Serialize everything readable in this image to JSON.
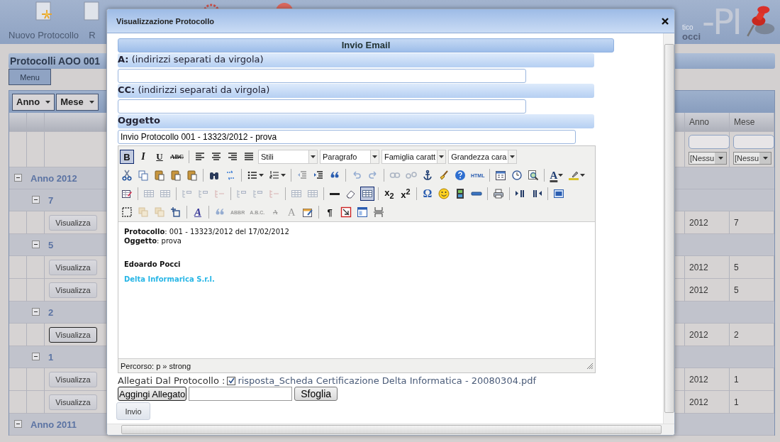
{
  "header": {
    "buttons": [
      {
        "label": "Nuovo Protocollo"
      },
      {
        "label": "R"
      }
    ],
    "logo": {
      "text": "-PI",
      "tagline": "tico",
      "user": "occi"
    }
  },
  "page_title": "Protocolli AOO 001",
  "menu_button": "Menu",
  "grid": {
    "group_by": [
      "Anno",
      "Mese"
    ],
    "columns": [
      "Anno",
      "Mese"
    ],
    "filters": [
      "[Nessu",
      "[Nessu"
    ],
    "groups": [
      {
        "label": "Anno 2012",
        "expanded": true,
        "children": [
          {
            "label": "7",
            "expanded": true,
            "records": [
              {
                "button": "Visualizza",
                "focused": false,
                "anno": "2012",
                "mese": "7"
              }
            ]
          },
          {
            "label": "5",
            "expanded": true,
            "records": [
              {
                "button": "Visualizza",
                "focused": false,
                "anno": "2012",
                "mese": "5"
              },
              {
                "button": "Visualizza",
                "focused": false,
                "anno": "2012",
                "mese": "5"
              }
            ]
          },
          {
            "label": "2",
            "expanded": true,
            "records": [
              {
                "button": "Visualizza",
                "focused": true,
                "anno": "2012",
                "mese": "2"
              }
            ]
          },
          {
            "label": "1",
            "expanded": true,
            "records": [
              {
                "button": "Visualizza",
                "focused": false,
                "anno": "2012",
                "mese": "1"
              },
              {
                "button": "Visualizza",
                "focused": false,
                "anno": "2012",
                "mese": "1"
              }
            ]
          }
        ]
      },
      {
        "label": "Anno 2011",
        "expanded": true
      }
    ]
  },
  "dialog": {
    "title": "Visualizzazione Protocollo",
    "section_title": "Invio Email",
    "fields": [
      {
        "label": "A:",
        "note": "(indirizzi separati da virgola)"
      },
      {
        "label": "CC:",
        "note": "(indirizzi separati da virgola)"
      },
      {
        "label": "Oggetto",
        "value": "Invio Protocollo 001 - 13323/2012 - prova"
      }
    ],
    "editor": {
      "toolbar": [
        [
          {
            "kind": "button",
            "label": "B",
            "selected": true,
            "disabled": false
          },
          {
            "kind": "button",
            "label": "I",
            "selected": false,
            "disabled": false
          },
          {
            "kind": "button",
            "label": "U",
            "selected": false,
            "disabled": false
          },
          {
            "kind": "button",
            "label": "ABC",
            "selected": false,
            "disabled": false
          },
          {
            "kind": "separator"
          },
          {
            "kind": "button",
            "selected": false,
            "disabled": false
          },
          {
            "kind": "button",
            "selected": false,
            "disabled": false
          },
          {
            "kind": "button",
            "selected": false,
            "disabled": false
          },
          {
            "kind": "button",
            "selected": false,
            "disabled": false
          },
          {
            "kind": "select",
            "label": "Stili"
          },
          {
            "kind": "select",
            "label": "Paragrafo"
          },
          {
            "kind": "select",
            "label": "Famiglia caratt"
          },
          {
            "kind": "select",
            "label": "Grandezza cara"
          }
        ],
        [
          {
            "kind": "button",
            "selected": false,
            "disabled": false
          },
          {
            "kind": "button",
            "selected": false,
            "disabled": false
          },
          {
            "kind": "button",
            "selected": false,
            "disabled": false
          },
          {
            "kind": "button",
            "selected": false,
            "disabled": false
          },
          {
            "kind": "button",
            "selected": false,
            "disabled": false
          },
          {
            "kind": "separator"
          },
          {
            "kind": "button",
            "selected": false,
            "disabled": false
          },
          {
            "kind": "button",
            "selected": false,
            "disabled": false
          },
          {
            "kind": "separator"
          },
          {
            "kind": "menu-button",
            "selected": false,
            "disabled": false
          },
          {
            "kind": "menu-button",
            "selected": false,
            "disabled": false
          },
          {
            "kind": "separator"
          },
          {
            "kind": "button",
            "selected": false,
            "disabled": true
          },
          {
            "kind": "button",
            "selected": false,
            "disabled": false
          },
          {
            "kind": "button",
            "selected": false,
            "disabled": false
          },
          {
            "kind": "separator"
          },
          {
            "kind": "button",
            "selected": false,
            "disabled": true
          },
          {
            "kind": "button",
            "selected": false,
            "disabled": true
          },
          {
            "kind": "separator"
          },
          {
            "kind": "button",
            "selected": false,
            "disabled": true
          },
          {
            "kind": "button",
            "selected": false,
            "disabled": true
          },
          {
            "kind": "button",
            "selected": false,
            "disabled": false
          },
          {
            "kind": "button",
            "selected": false,
            "disabled": false
          },
          {
            "kind": "button",
            "selected": false,
            "disabled": false
          },
          {
            "kind": "button",
            "label": "HTML",
            "selected": false,
            "disabled": false
          },
          {
            "kind": "separator"
          },
          {
            "kind": "button",
            "selected": false,
            "disabled": false
          },
          {
            "kind": "button",
            "selected": false,
            "disabled": false
          },
          {
            "kind": "button",
            "selected": false,
            "disabled": false
          },
          {
            "kind": "separator"
          },
          {
            "kind": "menu-button",
            "label": "A",
            "selected": false,
            "disabled": false
          },
          {
            "kind": "menu-button",
            "selected": false,
            "disabled": false
          }
        ],
        [
          {
            "kind": "button",
            "selected": false,
            "disabled": false
          },
          {
            "kind": "separator"
          },
          {
            "kind": "button",
            "selected": false,
            "disabled": true
          },
          {
            "kind": "button",
            "selected": false,
            "disabled": true
          },
          {
            "kind": "separator"
          },
          {
            "kind": "button",
            "selected": false,
            "disabled": true
          },
          {
            "kind": "button",
            "selected": false,
            "disabled": true
          },
          {
            "kind": "button",
            "selected": false,
            "disabled": true
          },
          {
            "kind": "separator"
          },
          {
            "kind": "button",
            "selected": false,
            "disabled": true
          },
          {
            "kind": "button",
            "selected": false,
            "disabled": true
          },
          {
            "kind": "button",
            "selected": false,
            "disabled": true
          },
          {
            "kind": "separator"
          },
          {
            "kind": "button",
            "selected": false,
            "disabled": true
          },
          {
            "kind": "button",
            "selected": false,
            "disabled": true
          },
          {
            "kind": "separator"
          },
          {
            "kind": "button",
            "selected": false,
            "disabled": false
          },
          {
            "kind": "button",
            "selected": false,
            "disabled": false
          },
          {
            "kind": "button",
            "selected": true,
            "disabled": false
          },
          {
            "kind": "separator"
          },
          {
            "kind": "button",
            "label": "x$_{2}$",
            "selected": false,
            "disabled": false
          },
          {
            "kind": "button",
            "label": "x$^{2}$",
            "selected": false,
            "disabled": false
          },
          {
            "kind": "separator"
          },
          {
            "kind": "button",
            "label": "Ω",
            "selected": false,
            "disabled": false
          },
          {
            "kind": "button",
            "selected": false,
            "disabled": false
          },
          {
            "kind": "button",
            "selected": false,
            "disabled": false
          },
          {
            "kind": "button",
            "selected": false,
            "disabled": false
          },
          {
            "kind": "separator"
          },
          {
            "kind": "button",
            "selected": false,
            "disabled": false
          },
          {
            "kind": "separator"
          },
          {
            "kind": "button",
            "selected": false,
            "disabled": false
          },
          {
            "kind": "button",
            "selected": false,
            "disabled": false
          },
          {
            "kind": "separator"
          },
          {
            "kind": "button",
            "selected": false,
            "disabled": false
          }
        ],
        [
          {
            "kind": "button",
            "selected": false,
            "disabled": false
          },
          {
            "kind": "button",
            "selected": false,
            "disabled": true
          },
          {
            "kind": "button",
            "selected": false,
            "disabled": true
          },
          {
            "kind": "button",
            "selected": false,
            "disabled": false
          },
          {
            "kind": "separator"
          },
          {
            "kind": "button",
            "label": "A",
            "selected": false,
            "disabled": false
          },
          {
            "kind": "separator"
          },
          {
            "kind": "button",
            "selected": false,
            "disabled": true
          },
          {
            "kind": "button",
            "label": "ABBR",
            "selected": false,
            "disabled": true
          },
          {
            "kind": "button",
            "label": "A.B.C.",
            "selected": false,
            "disabled": true
          },
          {
            "kind": "button",
            "label": "A",
            "selected": false,
            "disabled": true
          },
          {
            "kind": "button",
            "label": "A",
            "selected": false,
            "disabled": true
          },
          {
            "kind": "button",
            "selected": false,
            "disabled": false
          },
          {
            "kind": "separator"
          },
          {
            "kind": "button",
            "label": "¶",
            "selected": false,
            "disabled": false
          },
          {
            "kind": "button",
            "selected": false,
            "disabled": false
          },
          {
            "kind": "button",
            "selected": false,
            "disabled": false
          },
          {
            "kind": "button",
            "selected": false,
            "disabled": false
          }
        ]
      ],
      "content": [
        {
          "kind": "line",
          "text": "**Protocollo**: 001 - 13323/2012 del 17/02/2012"
        },
        {
          "kind": "line",
          "text": "**Oggetto**: prova"
        },
        {
          "kind": "signature",
          "text": "Edoardo Pocci"
        },
        {
          "kind": "company",
          "text": "Delta Informarica S.r.l."
        }
      ],
      "status": "Percorso: p » strong"
    },
    "attachments": {
      "label": "Allegati Dal Protocollo :",
      "files": [
        {
          "name": "risposta_Scheda Certificazione Delta Informatica - 20080304.pdf",
          "checked": true
        }
      ]
    },
    "add_button": "Aggingi Allegato",
    "browse_button": "Sfoglia",
    "send_button": "Invio"
  }
}
